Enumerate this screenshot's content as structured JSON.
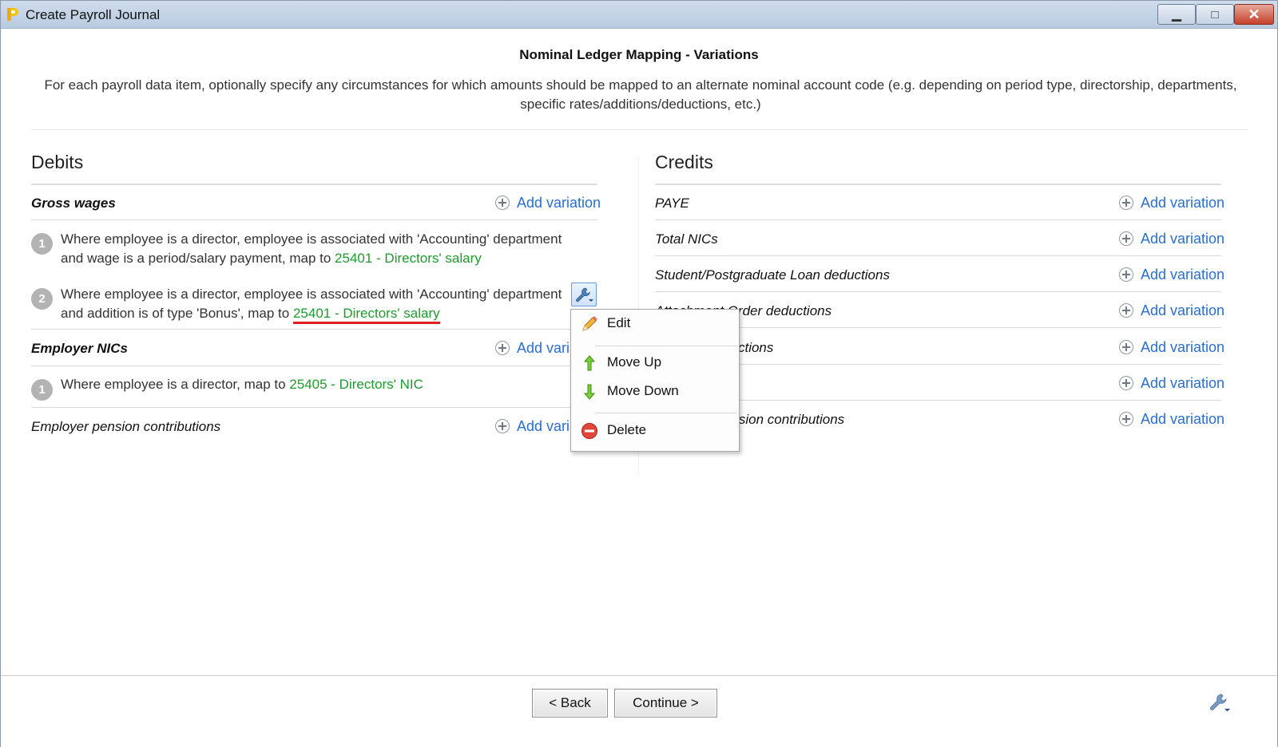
{
  "window": {
    "title": "Create Payroll Journal",
    "controls": {
      "minimize": "▁",
      "maximize": "□",
      "close": "✕"
    }
  },
  "page": {
    "heading": "Nominal Ledger Mapping - Variations",
    "description": "For each payroll data item, optionally specify any circumstances for which amounts should be mapped to an alternate nominal account code (e.g. depending on period type, directorship, departments, specific rates/additions/deductions, etc.)"
  },
  "add_variation_label": "Add variation",
  "debits": {
    "title": "Debits",
    "items": [
      {
        "label": "Gross wages",
        "variations": [
          {
            "number": "1",
            "text": "Where employee is a director, employee is associated with 'Accounting' department and wage is a period/salary payment, map to ",
            "account": "25401 - Directors' salary"
          },
          {
            "number": "2",
            "text": "Where employee is a director, employee is associated with 'Accounting' department and addition is of type 'Bonus', map to ",
            "account": "25401 - Directors' salary"
          }
        ]
      },
      {
        "label": "Employer NICs",
        "variations": [
          {
            "number": "1",
            "text": "Where employee is a director, map to ",
            "account": "25405 - Directors' NIC"
          }
        ]
      },
      {
        "label": "Employer pension contributions",
        "variations": []
      }
    ]
  },
  "credits": {
    "title": "Credits",
    "items": [
      {
        "label": "PAYE"
      },
      {
        "label": "Total NICs"
      },
      {
        "label": "Student/Postgraduate Loan deductions"
      },
      {
        "label": "Attachment Order deductions"
      },
      {
        "label": "Pension deductions"
      },
      {
        "label": ""
      },
      {
        "label": "Employer pension contributions"
      }
    ]
  },
  "context_menu": {
    "items": [
      {
        "label": "Edit",
        "icon": "pencil-icon"
      },
      {
        "label": "Move Up",
        "icon": "arrow-up-icon"
      },
      {
        "label": "Move Down",
        "icon": "arrow-down-icon"
      },
      {
        "label": "Delete",
        "icon": "delete-icon"
      }
    ]
  },
  "footer": {
    "back_label": "< Back",
    "continue_label": "Continue >"
  },
  "colors": {
    "link_blue": "#2a6fd0",
    "account_green": "#1e9a2e",
    "highlight_red": "#e02020"
  }
}
